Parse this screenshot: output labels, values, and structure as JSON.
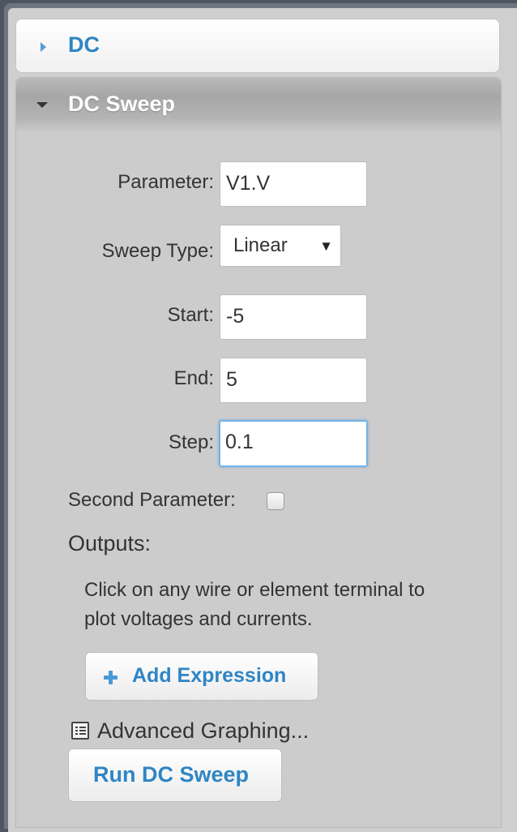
{
  "accordion": {
    "dc": {
      "title": "DC"
    },
    "dc_sweep": {
      "title": "DC Sweep"
    }
  },
  "form": {
    "parameter": {
      "label": "Parameter:",
      "value": "V1.V"
    },
    "sweep_type": {
      "label": "Sweep Type:",
      "value": "Linear",
      "caret": "▼"
    },
    "start": {
      "label": "Start:",
      "value": "-5"
    },
    "end": {
      "label": "End:",
      "value": "5"
    },
    "step": {
      "label": "Step:",
      "value": "0.1"
    },
    "second_parameter": {
      "label": "Second Parameter:",
      "checked": false
    }
  },
  "outputs": {
    "heading": "Outputs:",
    "hint_line1": "Click on any wire or element terminal to",
    "hint_line2": "plot voltages and currents.",
    "add_expression_label": "Add Expression"
  },
  "advanced_graphing": {
    "label": "Advanced Graphing..."
  },
  "run_button": {
    "label": "Run DC Sweep"
  },
  "colors": {
    "accent": "#2e85c4",
    "focus": "#73b4e8"
  }
}
